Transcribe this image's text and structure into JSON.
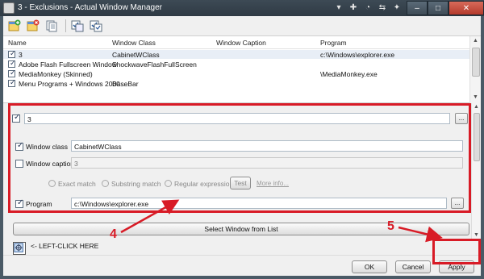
{
  "window": {
    "title": "3 - Exclusions - Actual Window Manager",
    "min_glyph": "–",
    "max_glyph": "□",
    "close_glyph": "✕",
    "titlebar_glyphs": [
      "▾",
      "✚",
      "◔",
      "⇆",
      "✦"
    ]
  },
  "toolbar": {
    "buttons": [
      {
        "name": "add-exclusion-button",
        "icon": "add-window-icon"
      },
      {
        "name": "delete-exclusion-button",
        "icon": "delete-window-icon"
      },
      {
        "name": "copy-exclusion-button",
        "icon": "copy-icon"
      },
      {
        "name": "check-all-button",
        "icon": "check-all-icon"
      },
      {
        "name": "uncheck-all-button",
        "icon": "uncheck-all-icon"
      }
    ]
  },
  "list": {
    "columns": [
      "Name",
      "Window Class",
      "Window Caption",
      "Program"
    ],
    "rows": [
      {
        "name": "3",
        "class": "CabinetWClass",
        "caption": "",
        "program": "c:\\Windows\\explorer.exe",
        "selected": true
      },
      {
        "name": "Adobe Flash Fullscreen Window",
        "class": "ShockwaveFlashFullScreen",
        "caption": "",
        "program": ""
      },
      {
        "name": "MediaMonkey (Skinned)",
        "class": "",
        "caption": "",
        "program": "\\MediaMonkey.exe"
      },
      {
        "name": "Menu Programs + Windows 2000 ...",
        "class": "BaseBar",
        "caption": "",
        "program": ""
      }
    ]
  },
  "details": {
    "name_value": "3",
    "browse_label": "...",
    "window_class_label": "Window class",
    "window_class_value": "CabinetWClass",
    "window_caption_label": "Window caption",
    "window_caption_value": "3",
    "match_options": [
      "Exact match",
      "Substring match",
      "Regular expression"
    ],
    "test_label": "Test",
    "more_info_label": "More info...",
    "program_label": "Program",
    "program_value": "c:\\Windows\\explorer.exe",
    "select_window_label": "Select Window from List",
    "left_click_label": "<- LEFT-CLICK HERE"
  },
  "annotations": {
    "marker_4": "4",
    "marker_5": "5",
    "color": "#d81b26"
  },
  "buttons": {
    "ok": "OK",
    "cancel": "Cancel",
    "apply": "Apply"
  }
}
